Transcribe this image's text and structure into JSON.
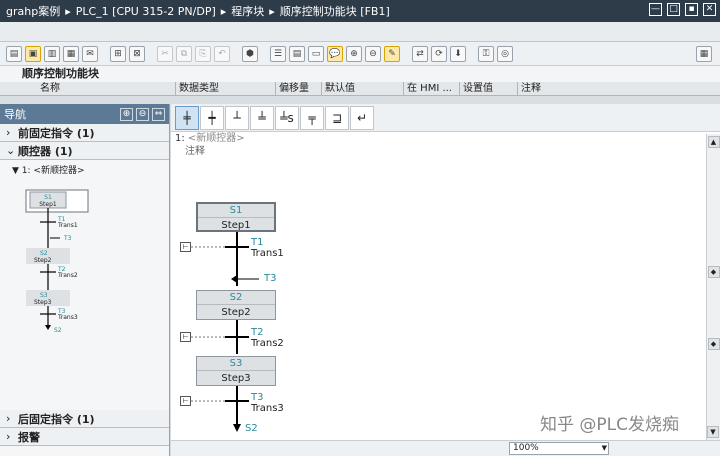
{
  "titlebar": {
    "crumbs": [
      "grahp案例",
      "PLC_1 [CPU 315-2 PN/DP]",
      "程序块",
      "顺序控制功能块 [FB1]"
    ],
    "separator": "▸"
  },
  "window_controls": [
    "—",
    "□",
    "▪",
    "✕"
  ],
  "block_title": "顺序控制功能块",
  "interface_columns": [
    "名称",
    "数据类型",
    "偏移量",
    "默认值",
    "在 HMI ...",
    "设置值",
    "注释"
  ],
  "navigation": {
    "title": "导航",
    "sections": {
      "pre": {
        "arrow": "›",
        "label": "前固定指令 (1)"
      },
      "seq": {
        "arrow": "⌄",
        "label": "顺控器 (1)"
      },
      "post": {
        "arrow": "›",
        "label": "后固定指令 (1)"
      },
      "alarms": {
        "arrow": "›",
        "label": "报警"
      }
    },
    "tree_item": "▼ 1: <新顺控器>",
    "mini": {
      "s1": "S1",
      "step1": "Step1",
      "t1": "T1",
      "trans1": "Trans1",
      "t3_jump": "T3",
      "s2": "S2",
      "step2": "Step2",
      "t2": "T2",
      "trans2": "Trans2",
      "s3": "S3",
      "step3": "Step3",
      "t3": "T3",
      "trans3": "Trans3",
      "s2_jump": "S2"
    }
  },
  "palette_tools": [
    "╪",
    "┿",
    "┴",
    "╧",
    "╧s",
    "╤",
    "⊒",
    "↵"
  ],
  "editor": {
    "seq_index": "1:",
    "seq_name": "<新顺控器>",
    "comment": "注释",
    "steps": [
      {
        "num": "S1",
        "name": "Step1"
      },
      {
        "num": "S2",
        "name": "Step2"
      },
      {
        "num": "S3",
        "name": "Step3"
      }
    ],
    "transitions": [
      {
        "id": "T1",
        "name": "Trans1"
      },
      {
        "id": "T2",
        "name": "Trans2"
      },
      {
        "id": "T3",
        "name": "Trans3"
      }
    ],
    "jump_in": "T3",
    "jump_out": "S2",
    "zoom": "100%"
  },
  "watermark": "知乎 @PLC发烧痴"
}
